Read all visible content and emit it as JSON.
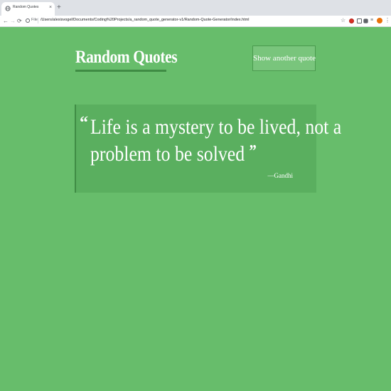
{
  "browser": {
    "tab_title": "Random Quotes",
    "tab_close": "×",
    "new_tab": "+",
    "nav": {
      "back": "←",
      "forward": "→",
      "reload": "⟳"
    },
    "scheme_label": "File",
    "url": "/Users/alexisvogel/Documents/Coding%20Projects/a_random_quote_generator-v1/Random-Quote-Generator/index.html",
    "star": "☆",
    "extensions_menu": "≡",
    "menu": "⋮"
  },
  "page": {
    "title": "Random Quotes",
    "button_label": "Show another quote",
    "quote": {
      "open_mark": "“",
      "line1": "Life is a mystery to be lived, not a",
      "line2": "problem to be solved",
      "close_mark": "”",
      "author": "—Gandhi"
    }
  },
  "colors": {
    "background": "#67bd6b",
    "card": "#5aaf5f",
    "accent": "#3f8c44",
    "button": "#79c57c",
    "text": "#ffffff"
  }
}
